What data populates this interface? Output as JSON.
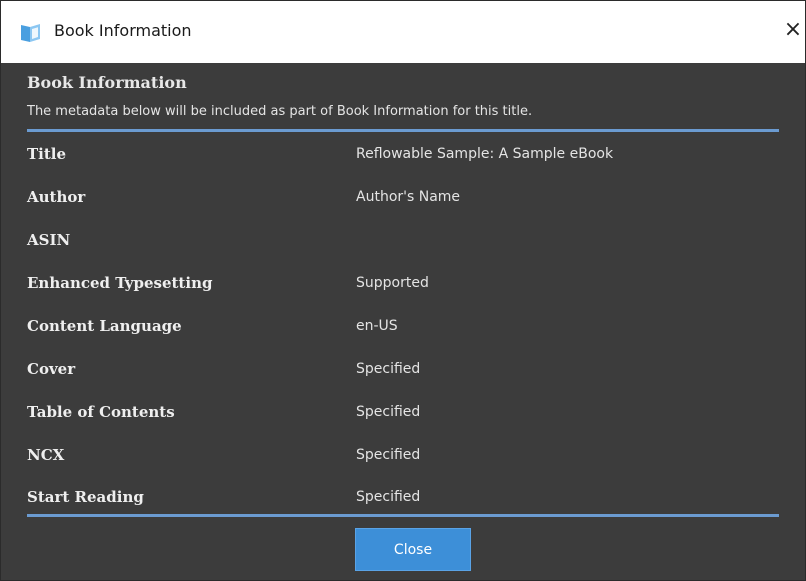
{
  "window": {
    "title": "Book Information",
    "close_glyph": "×"
  },
  "header": {
    "title": "Book Information",
    "description": "The metadata below will be included as part of Book Information for this title."
  },
  "rows": [
    {
      "label": "Title",
      "value": "Reflowable Sample: A Sample eBook"
    },
    {
      "label": "Author",
      "value": "Author's Name"
    },
    {
      "label": "ASIN",
      "value": ""
    },
    {
      "label": "Enhanced Typesetting",
      "value": "Supported"
    },
    {
      "label": "Content Language",
      "value": "en-US"
    },
    {
      "label": "Cover",
      "value": "Specified"
    },
    {
      "label": "Table of Contents",
      "value": "Specified"
    },
    {
      "label": "NCX",
      "value": "Specified"
    },
    {
      "label": "Start Reading",
      "value": "Specified"
    }
  ],
  "footer": {
    "close_label": "Close"
  },
  "icons": {
    "app": "book-icon",
    "close": "close-icon"
  },
  "colors": {
    "dialog_background": "#3c3c3c",
    "accent_divider": "#6b9bd1",
    "button_blue": "#3d8fd8"
  }
}
